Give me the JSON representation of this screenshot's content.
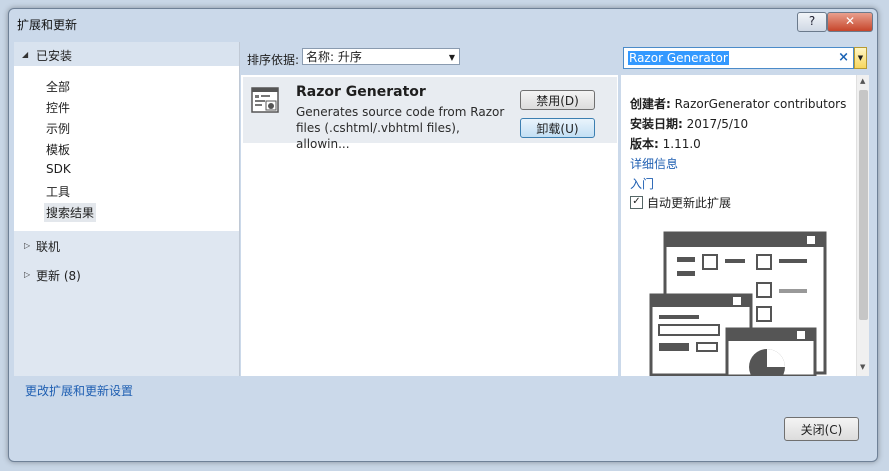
{
  "window": {
    "title": "扩展和更新",
    "help_label": "?",
    "close_label": "✕"
  },
  "tree": {
    "installed": "已安装",
    "installed_items": [
      "全部",
      "控件",
      "示例",
      "模板",
      "SDK",
      "工具",
      "搜索结果"
    ],
    "online": "联机",
    "updates": "更新 (8)"
  },
  "toolbar": {
    "sort_label": "排序依据:",
    "sort_value": "名称: 升序"
  },
  "search": {
    "value": "Razor Generator",
    "clear": "×"
  },
  "extension": {
    "name": "Razor Generator",
    "desc1": "Generates source code from Razor",
    "desc2": "files (.cshtml/.vbhtml files), allowin...",
    "disable_label": "禁用(D)",
    "uninstall_label": "卸载(U)"
  },
  "details": {
    "creator_label": "创建者:",
    "creator": "RazorGenerator contributors",
    "install_date_label": "安装日期:",
    "install_date": "2017/5/10",
    "version_label": "版本:",
    "version": "1.11.0",
    "more_info": "详细信息",
    "getting_started": "入门",
    "auto_update_label": "自动更新此扩展",
    "auto_update_checked": true
  },
  "footer": {
    "settings_link": "更改扩展和更新设置",
    "close_label": "关闭(C)"
  },
  "icons": {
    "window_close": "close-icon",
    "help": "help-icon",
    "search_clear": "clear-icon",
    "expand": "triangle-right-icon",
    "collapse": "triangle-down-icon",
    "extension": "razor-generator-icon"
  }
}
